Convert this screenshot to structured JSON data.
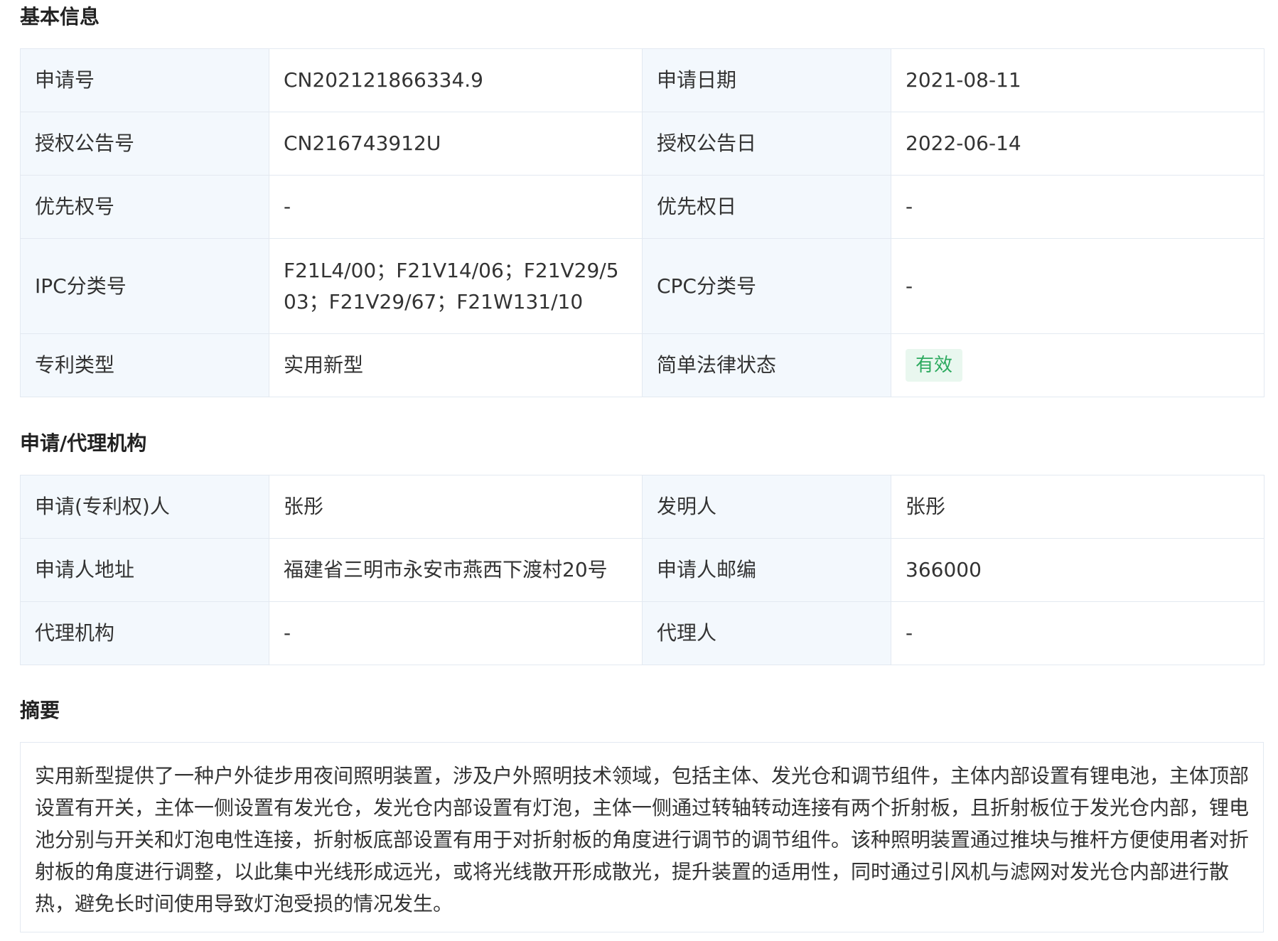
{
  "sections": {
    "basic_info": "基本信息",
    "agency": "申请/代理机构",
    "abstract": "摘要"
  },
  "basic": {
    "app_no_label": "申请号",
    "app_no": "CN202121866334.9",
    "app_date_label": "申请日期",
    "app_date": "2021-08-11",
    "grant_no_label": "授权公告号",
    "grant_no": "CN216743912U",
    "grant_date_label": "授权公告日",
    "grant_date": "2022-06-14",
    "priority_no_label": "优先权号",
    "priority_no": "-",
    "priority_date_label": "优先权日",
    "priority_date": "-",
    "ipc_label": "IPC分类号",
    "ipc": "F21L4/00；F21V14/06；F21V29/503；F21V29/67；F21W131/10",
    "cpc_label": "CPC分类号",
    "cpc": "-",
    "patent_type_label": "专利类型",
    "patent_type": "实用新型",
    "legal_status_label": "简单法律状态",
    "legal_status": "有效"
  },
  "agency": {
    "applicant_label": "申请(专利权)人",
    "applicant": "张彤",
    "inventor_label": "发明人",
    "inventor": "张彤",
    "address_label": "申请人地址",
    "address": "福建省三明市永安市燕西下渡村20号",
    "postcode_label": "申请人邮编",
    "postcode": "366000",
    "agency_label": "代理机构",
    "agency": "-",
    "agent_label": "代理人",
    "agent": "-"
  },
  "abstract": {
    "text": "实用新型提供了一种户外徒步用夜间照明装置，涉及户外照明技术领域，包括主体、发光仓和调节组件，主体内部设置有锂电池，主体顶部设置有开关，主体一侧设置有发光仓，发光仓内部设置有灯泡，主体一侧通过转轴转动连接有两个折射板，且折射板位于发光仓内部，锂电池分别与开关和灯泡电性连接，折射板底部设置有用于对折射板的角度进行调节的调节组件。该种照明装置通过推块与推杆方便使用者对折射板的角度进行调整，以此集中光线形成远光，或将光线散开形成散光，提升装置的适用性，同时通过引风机与滤网对发光仓内部进行散热，避免长时间使用导致灯泡受损的情况发生。"
  },
  "colors": {
    "label_bg": "#f3f8fd",
    "border": "#e3e9f1",
    "badge_bg": "#e9f7ef",
    "badge_text": "#2daa5f"
  }
}
